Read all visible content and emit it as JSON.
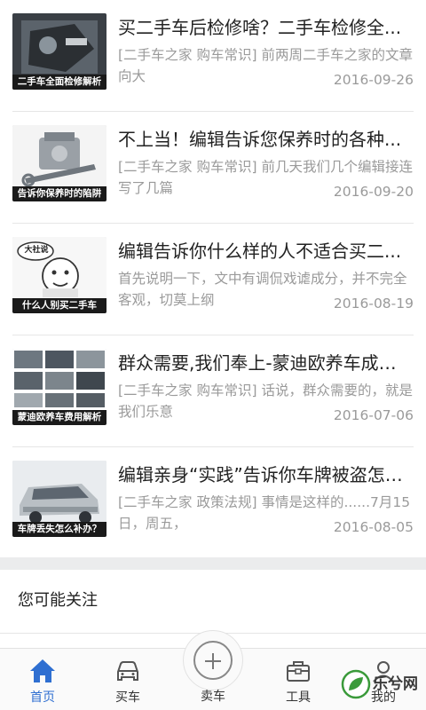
{
  "articles": [
    {
      "thumb_caption": "二手车全面检修解析",
      "title": "买二手车后检修啥？二手车检修全...",
      "summary": "[二手车之家 购车常识] 前两周二手车之家的文章向大",
      "date": "2016-09-26"
    },
    {
      "thumb_caption": "告诉你保养时的陷阱",
      "title": "不上当！编辑告诉您保养时的各种...",
      "summary": "[二手车之家 购车常识] 前几天我们几个编辑接连写了几篇",
      "date": "2016-09-20"
    },
    {
      "thumb_caption": "什么人别买二手车",
      "thumb_badge": "大社说",
      "title": "编辑告诉你什么样的人不适合买二...",
      "summary": "首先说明一下，文中有调侃戏谑成分，并不完全客观，切莫上纲",
      "date": "2016-08-19"
    },
    {
      "thumb_caption": "蒙迪欧养车费用解析",
      "title": "群众需要,我们奉上-蒙迪欧养车成本...",
      "summary": "[二手车之家 购车常识] 话说，群众需要的，就是我们乐意",
      "date": "2016-07-06"
    },
    {
      "thumb_caption": "车牌丢失怎么补办？",
      "title": "编辑亲身“实践”告诉你车牌被盗怎么...",
      "summary": "[二手车之家 政策法规] 事情是这样的......7月15日，周五，",
      "date": "2016-08-05"
    }
  ],
  "maybe_section": {
    "title": "您可能关注"
  },
  "tabbar": {
    "home": "首页",
    "buy": "买车",
    "sell": "卖车",
    "tools": "工具",
    "mine": "我的"
  },
  "watermark": {
    "text": "乐兮网"
  },
  "colors": {
    "accent": "#2f6fd1",
    "muted": "#9a9a9a",
    "band": "#ebeced"
  }
}
